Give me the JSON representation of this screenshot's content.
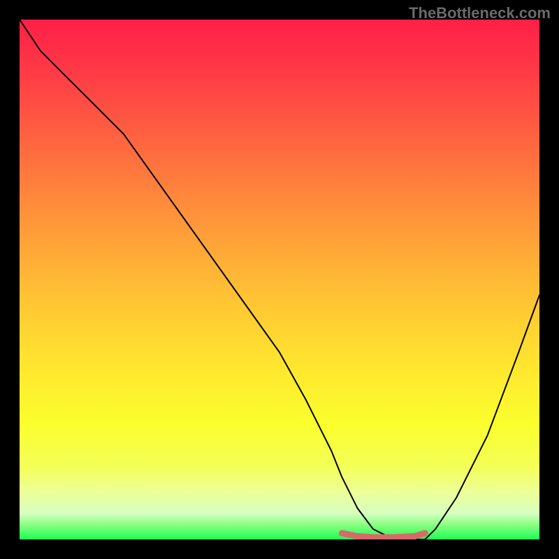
{
  "watermark": "TheBottleneck.com",
  "chart_data": {
    "type": "line",
    "title": "",
    "xlabel": "",
    "ylabel": "",
    "xlim": [
      0,
      100
    ],
    "ylim": [
      0,
      100
    ],
    "gradient_colors": {
      "top": "#ff1f47",
      "mid": "#ffe92e",
      "bottom": "#1aff55"
    },
    "series": [
      {
        "name": "bottleneck-curve",
        "color": "#000000",
        "x": [
          0,
          4,
          8,
          14,
          20,
          30,
          40,
          50,
          55,
          60,
          62,
          65,
          68,
          72,
          76,
          78,
          80,
          84,
          90,
          96,
          100
        ],
        "y": [
          100,
          94,
          90,
          84,
          78,
          64,
          50,
          36,
          27,
          17,
          12,
          6,
          2,
          0,
          0,
          0,
          2,
          8,
          20,
          36,
          47
        ]
      },
      {
        "name": "highlight-flat",
        "color": "#d66a6a",
        "x": [
          62,
          65,
          68,
          72,
          76,
          78
        ],
        "y": [
          1.2,
          0.6,
          0.4,
          0.4,
          0.6,
          1.2
        ]
      }
    ]
  }
}
